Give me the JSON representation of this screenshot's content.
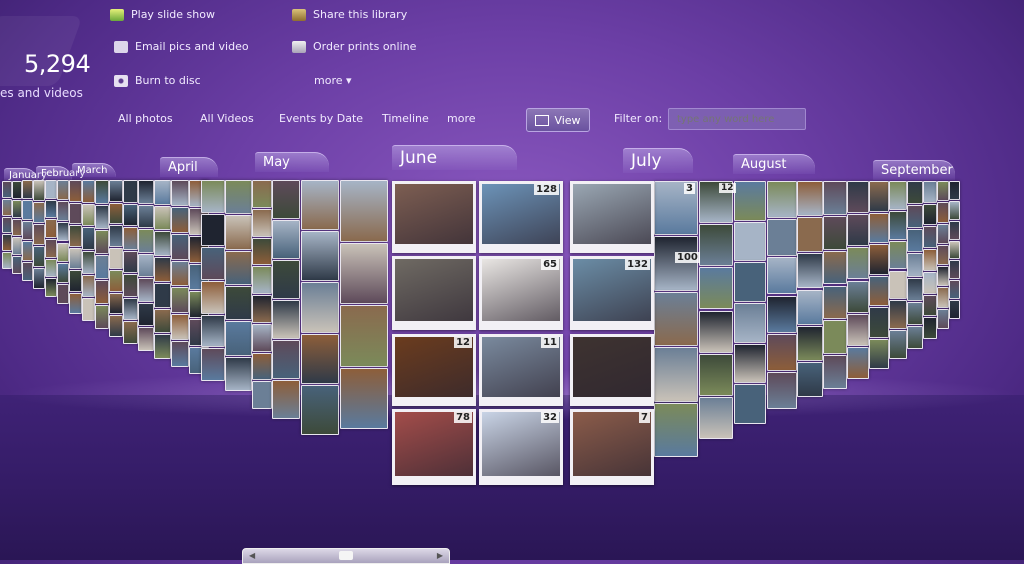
{
  "library": {
    "count": "5,294",
    "subtitle": "es and videos"
  },
  "tasks": {
    "play_slide_show": "Play slide show",
    "email": "Email pics and video",
    "burn": "Burn to disc",
    "share": "Share this library",
    "order": "Order prints online",
    "more": "more ▾"
  },
  "nav": {
    "all_photos": "All photos",
    "all_videos": "All Videos",
    "events_by_date": "Events by Date",
    "timeline": "Timeline",
    "more": "more",
    "view": "View",
    "filter_label": "Filter on:",
    "search_placeholder": "type any word here"
  },
  "months": {
    "january": "January",
    "february": "February",
    "march": "March",
    "april": "April",
    "may": "May",
    "june": "June",
    "july": "July",
    "august": "August",
    "september": "September"
  },
  "tiles": [
    {
      "badge": "",
      "color": "#7d5e52",
      "caption": ""
    },
    {
      "badge": "128",
      "color": "#6c93b8",
      "caption": ""
    },
    {
      "badge": "",
      "color": "#9aa7b3",
      "caption": ""
    },
    {
      "badge": "",
      "color": "#6f6a63",
      "caption": ""
    },
    {
      "badge": "65",
      "color": "#e9e6e3",
      "caption": ""
    },
    {
      "badge": "132",
      "color": "#6b8da6",
      "caption": ""
    },
    {
      "badge": "12",
      "color": "#6b3c1e",
      "caption": ""
    },
    {
      "badge": "11",
      "color": "#7a8a9e",
      "caption": ""
    },
    {
      "badge": "",
      "color": "#3e3330",
      "caption": ""
    },
    {
      "badge": "78",
      "color": "#a34d4a",
      "caption": ""
    },
    {
      "badge": "32",
      "color": "#c9d4e6",
      "caption": ""
    },
    {
      "badge": "7",
      "color": "#8b5c4a",
      "caption": ""
    }
  ],
  "side_badges": {
    "july_top": "3",
    "july_second": "100",
    "aug_top": "12"
  },
  "colors": {
    "accent": "#6c3fa6",
    "tile_frame": "#f2f0f5"
  }
}
